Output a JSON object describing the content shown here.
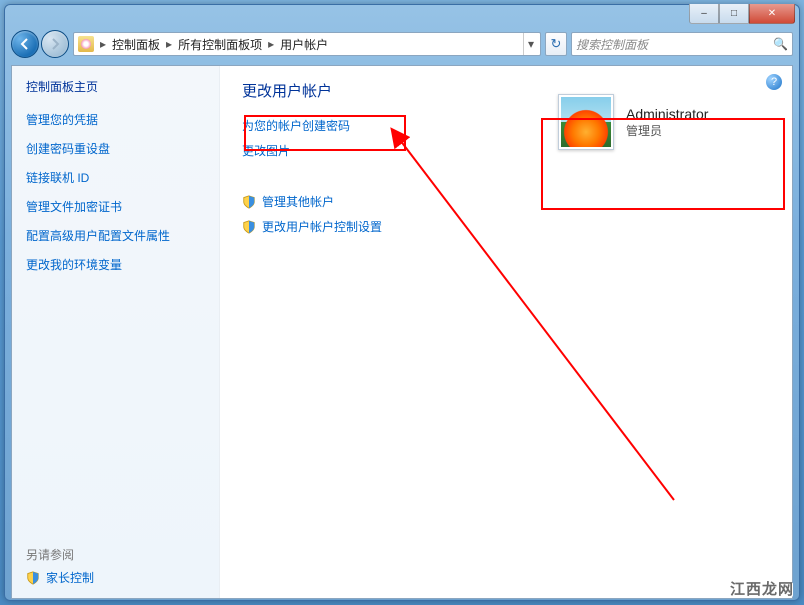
{
  "titlebar": {
    "minimize": "–",
    "maximize": "□",
    "close": "✕"
  },
  "breadcrumb": {
    "root_icon": "control-panel-icon",
    "items": [
      "控制面板",
      "所有控制面板项",
      "用户帐户"
    ]
  },
  "search": {
    "placeholder": "搜索控制面板"
  },
  "sidebar": {
    "title": "控制面板主页",
    "links": [
      "管理您的凭据",
      "创建密码重设盘",
      "链接联机 ID",
      "管理文件加密证书",
      "配置高级用户配置文件属性",
      "更改我的环境变量"
    ],
    "see_also": "另请参阅",
    "footer_link": "家长控制"
  },
  "main": {
    "title": "更改用户帐户",
    "tasks_top": [
      "为您的帐户创建密码",
      "更改图片"
    ],
    "tasks_shield": [
      "管理其他帐户",
      "更改用户帐户控制设置"
    ]
  },
  "user": {
    "name": "Administrator",
    "role": "管理员"
  },
  "watermark": "江西龙网"
}
